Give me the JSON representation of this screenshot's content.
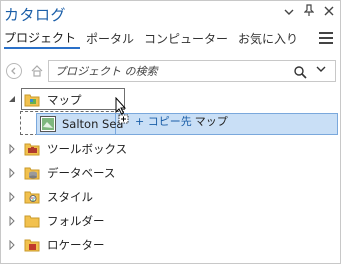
{
  "pane": {
    "title": "カタログ",
    "title_icons": [
      "chevron-down-icon",
      "pin-icon",
      "close-icon"
    ]
  },
  "tabs": [
    {
      "label": "プロジェクト",
      "active": true
    },
    {
      "label": "ポータル",
      "active": false
    },
    {
      "label": "コンピューター",
      "active": false
    },
    {
      "label": "お気に入り",
      "active": false
    }
  ],
  "search": {
    "placeholder": "プロジェクト の検索",
    "value": ""
  },
  "tree": {
    "maps": {
      "label": "マップ",
      "expanded": true
    },
    "items": [
      {
        "label": "ツールボックス",
        "icon": "toolbox-folder-icon"
      },
      {
        "label": "データベース",
        "icon": "database-folder-icon"
      },
      {
        "label": "スタイル",
        "icon": "style-folder-icon"
      },
      {
        "label": "フォルダー",
        "icon": "folder-icon"
      },
      {
        "label": "ロケーター",
        "icon": "locator-folder-icon"
      }
    ]
  },
  "drag": {
    "item_label": "Salton Sea",
    "hint_operation": "+ コピー先",
    "hint_target": "マップ"
  },
  "colors": {
    "accent": "#1a5ea8",
    "selection": "#c9dff6",
    "folder": "#f2c14e"
  }
}
